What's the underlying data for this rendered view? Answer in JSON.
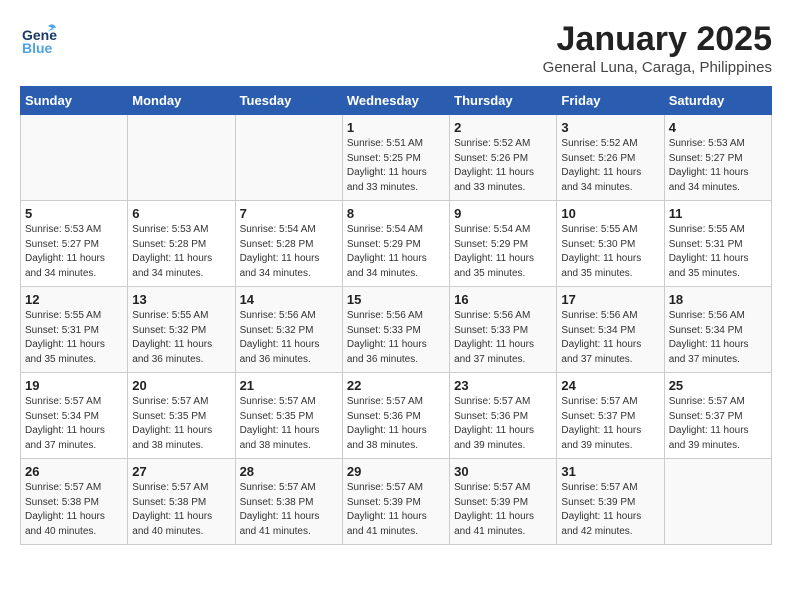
{
  "logo": {
    "line1": "General",
    "line2": "Blue"
  },
  "title": "January 2025",
  "subtitle": "General Luna, Caraga, Philippines",
  "days_of_week": [
    "Sunday",
    "Monday",
    "Tuesday",
    "Wednesday",
    "Thursday",
    "Friday",
    "Saturday"
  ],
  "weeks": [
    [
      {
        "day": "",
        "info": ""
      },
      {
        "day": "",
        "info": ""
      },
      {
        "day": "",
        "info": ""
      },
      {
        "day": "1",
        "info": "Sunrise: 5:51 AM\nSunset: 5:25 PM\nDaylight: 11 hours\nand 33 minutes."
      },
      {
        "day": "2",
        "info": "Sunrise: 5:52 AM\nSunset: 5:26 PM\nDaylight: 11 hours\nand 33 minutes."
      },
      {
        "day": "3",
        "info": "Sunrise: 5:52 AM\nSunset: 5:26 PM\nDaylight: 11 hours\nand 34 minutes."
      },
      {
        "day": "4",
        "info": "Sunrise: 5:53 AM\nSunset: 5:27 PM\nDaylight: 11 hours\nand 34 minutes."
      }
    ],
    [
      {
        "day": "5",
        "info": "Sunrise: 5:53 AM\nSunset: 5:27 PM\nDaylight: 11 hours\nand 34 minutes."
      },
      {
        "day": "6",
        "info": "Sunrise: 5:53 AM\nSunset: 5:28 PM\nDaylight: 11 hours\nand 34 minutes."
      },
      {
        "day": "7",
        "info": "Sunrise: 5:54 AM\nSunset: 5:28 PM\nDaylight: 11 hours\nand 34 minutes."
      },
      {
        "day": "8",
        "info": "Sunrise: 5:54 AM\nSunset: 5:29 PM\nDaylight: 11 hours\nand 34 minutes."
      },
      {
        "day": "9",
        "info": "Sunrise: 5:54 AM\nSunset: 5:29 PM\nDaylight: 11 hours\nand 35 minutes."
      },
      {
        "day": "10",
        "info": "Sunrise: 5:55 AM\nSunset: 5:30 PM\nDaylight: 11 hours\nand 35 minutes."
      },
      {
        "day": "11",
        "info": "Sunrise: 5:55 AM\nSunset: 5:31 PM\nDaylight: 11 hours\nand 35 minutes."
      }
    ],
    [
      {
        "day": "12",
        "info": "Sunrise: 5:55 AM\nSunset: 5:31 PM\nDaylight: 11 hours\nand 35 minutes."
      },
      {
        "day": "13",
        "info": "Sunrise: 5:55 AM\nSunset: 5:32 PM\nDaylight: 11 hours\nand 36 minutes."
      },
      {
        "day": "14",
        "info": "Sunrise: 5:56 AM\nSunset: 5:32 PM\nDaylight: 11 hours\nand 36 minutes."
      },
      {
        "day": "15",
        "info": "Sunrise: 5:56 AM\nSunset: 5:33 PM\nDaylight: 11 hours\nand 36 minutes."
      },
      {
        "day": "16",
        "info": "Sunrise: 5:56 AM\nSunset: 5:33 PM\nDaylight: 11 hours\nand 37 minutes."
      },
      {
        "day": "17",
        "info": "Sunrise: 5:56 AM\nSunset: 5:34 PM\nDaylight: 11 hours\nand 37 minutes."
      },
      {
        "day": "18",
        "info": "Sunrise: 5:56 AM\nSunset: 5:34 PM\nDaylight: 11 hours\nand 37 minutes."
      }
    ],
    [
      {
        "day": "19",
        "info": "Sunrise: 5:57 AM\nSunset: 5:34 PM\nDaylight: 11 hours\nand 37 minutes."
      },
      {
        "day": "20",
        "info": "Sunrise: 5:57 AM\nSunset: 5:35 PM\nDaylight: 11 hours\nand 38 minutes."
      },
      {
        "day": "21",
        "info": "Sunrise: 5:57 AM\nSunset: 5:35 PM\nDaylight: 11 hours\nand 38 minutes."
      },
      {
        "day": "22",
        "info": "Sunrise: 5:57 AM\nSunset: 5:36 PM\nDaylight: 11 hours\nand 38 minutes."
      },
      {
        "day": "23",
        "info": "Sunrise: 5:57 AM\nSunset: 5:36 PM\nDaylight: 11 hours\nand 39 minutes."
      },
      {
        "day": "24",
        "info": "Sunrise: 5:57 AM\nSunset: 5:37 PM\nDaylight: 11 hours\nand 39 minutes."
      },
      {
        "day": "25",
        "info": "Sunrise: 5:57 AM\nSunset: 5:37 PM\nDaylight: 11 hours\nand 39 minutes."
      }
    ],
    [
      {
        "day": "26",
        "info": "Sunrise: 5:57 AM\nSunset: 5:38 PM\nDaylight: 11 hours\nand 40 minutes."
      },
      {
        "day": "27",
        "info": "Sunrise: 5:57 AM\nSunset: 5:38 PM\nDaylight: 11 hours\nand 40 minutes."
      },
      {
        "day": "28",
        "info": "Sunrise: 5:57 AM\nSunset: 5:38 PM\nDaylight: 11 hours\nand 41 minutes."
      },
      {
        "day": "29",
        "info": "Sunrise: 5:57 AM\nSunset: 5:39 PM\nDaylight: 11 hours\nand 41 minutes."
      },
      {
        "day": "30",
        "info": "Sunrise: 5:57 AM\nSunset: 5:39 PM\nDaylight: 11 hours\nand 41 minutes."
      },
      {
        "day": "31",
        "info": "Sunrise: 5:57 AM\nSunset: 5:39 PM\nDaylight: 11 hours\nand 42 minutes."
      },
      {
        "day": "",
        "info": ""
      }
    ]
  ]
}
